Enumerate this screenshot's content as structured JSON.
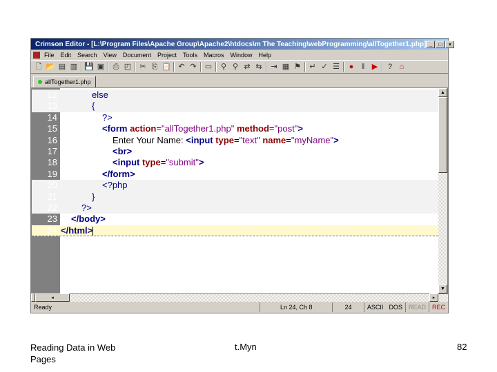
{
  "window": {
    "title": "Crimson Editor - [L:\\Program Files\\Apache Group\\Apache2\\htdocs\\m The Teaching\\webProgramming\\allTogether1.php]",
    "controls": [
      "_",
      "□",
      "×"
    ]
  },
  "menu": [
    "File",
    "Edit",
    "Search",
    "View",
    "Document",
    "Project",
    "Tools",
    "Macros",
    "Window",
    "Help"
  ],
  "toolbar": [
    "new-file",
    "open-file",
    "open-remote",
    "open-folder",
    "save",
    "save-all",
    "print",
    "print-preview",
    "cut",
    "copy",
    "paste",
    "undo",
    "redo",
    "toggle-view",
    "find",
    "find-next",
    "replace",
    "replace-all",
    "goto",
    "directory",
    "ftp",
    "word-wrap",
    "spell",
    "line-numbers",
    "record-macro",
    "pause",
    "play",
    "help",
    "home"
  ],
  "tab": {
    "label": "allTogether1.php"
  },
  "code": [
    {
      "n": "12",
      "php": true,
      "indent": 3,
      "tokens": [
        {
          "t": "else",
          "c": "k"
        }
      ]
    },
    {
      "n": "13",
      "php": true,
      "indent": 3,
      "tokens": [
        {
          "t": "{",
          "c": "k"
        }
      ]
    },
    {
      "n": "14",
      "php": false,
      "indent": 4,
      "tokens": [
        {
          "t": "?>",
          "c": "k"
        }
      ]
    },
    {
      "n": "15",
      "php": false,
      "indent": 4,
      "tokens": [
        {
          "t": "<form ",
          "c": "tg"
        },
        {
          "t": "action",
          "c": "at"
        },
        {
          "t": "=",
          "c": "tx"
        },
        {
          "t": "\"allTogether1.php\" ",
          "c": "st"
        },
        {
          "t": "method",
          "c": "at"
        },
        {
          "t": "=",
          "c": "tx"
        },
        {
          "t": "\"post\"",
          "c": "st"
        },
        {
          "t": ">",
          "c": "tg"
        }
      ]
    },
    {
      "n": "16",
      "php": false,
      "indent": 5,
      "tokens": [
        {
          "t": "Enter Your Name: ",
          "c": "tx"
        },
        {
          "t": "<input ",
          "c": "tg"
        },
        {
          "t": "type",
          "c": "at"
        },
        {
          "t": "=",
          "c": "tx"
        },
        {
          "t": "\"text\" ",
          "c": "st"
        },
        {
          "t": "name",
          "c": "at"
        },
        {
          "t": "=",
          "c": "tx"
        },
        {
          "t": "\"myName\"",
          "c": "st"
        },
        {
          "t": ">",
          "c": "tg"
        }
      ]
    },
    {
      "n": "17",
      "php": false,
      "indent": 5,
      "tokens": [
        {
          "t": "<br>",
          "c": "tg"
        }
      ]
    },
    {
      "n": "18",
      "php": false,
      "indent": 5,
      "tokens": [
        {
          "t": "<input ",
          "c": "tg"
        },
        {
          "t": "type",
          "c": "at"
        },
        {
          "t": "=",
          "c": "tx"
        },
        {
          "t": "\"submit\"",
          "c": "st"
        },
        {
          "t": ">",
          "c": "tg"
        }
      ]
    },
    {
      "n": "19",
      "php": false,
      "indent": 4,
      "tokens": [
        {
          "t": "</form>",
          "c": "tg"
        }
      ]
    },
    {
      "n": "20",
      "php": true,
      "indent": 4,
      "tokens": [
        {
          "t": "<?php",
          "c": "k"
        }
      ]
    },
    {
      "n": "21",
      "php": true,
      "indent": 3,
      "tokens": [
        {
          "t": "}",
          "c": "k"
        }
      ]
    },
    {
      "n": "22",
      "php": true,
      "indent": 2,
      "tokens": [
        {
          "t": "?>",
          "c": "k"
        }
      ]
    },
    {
      "n": "23",
      "php": false,
      "indent": 1,
      "tokens": [
        {
          "t": "</body>",
          "c": "tg"
        }
      ]
    },
    {
      "n": "24",
      "php": false,
      "indent": 0,
      "current": true,
      "tokens": [
        {
          "t": "</html>",
          "c": "tg"
        }
      ]
    }
  ],
  "status": {
    "ready": "Ready",
    "position": "Ln 24, Ch 8",
    "lines": "24",
    "encoding": "ASCII",
    "format": "DOS",
    "read": "READ",
    "rec": "REC"
  },
  "footer": {
    "left1": "Reading Data in Web",
    "left2": "Pages",
    "center": "t.Myn",
    "page": "82"
  }
}
